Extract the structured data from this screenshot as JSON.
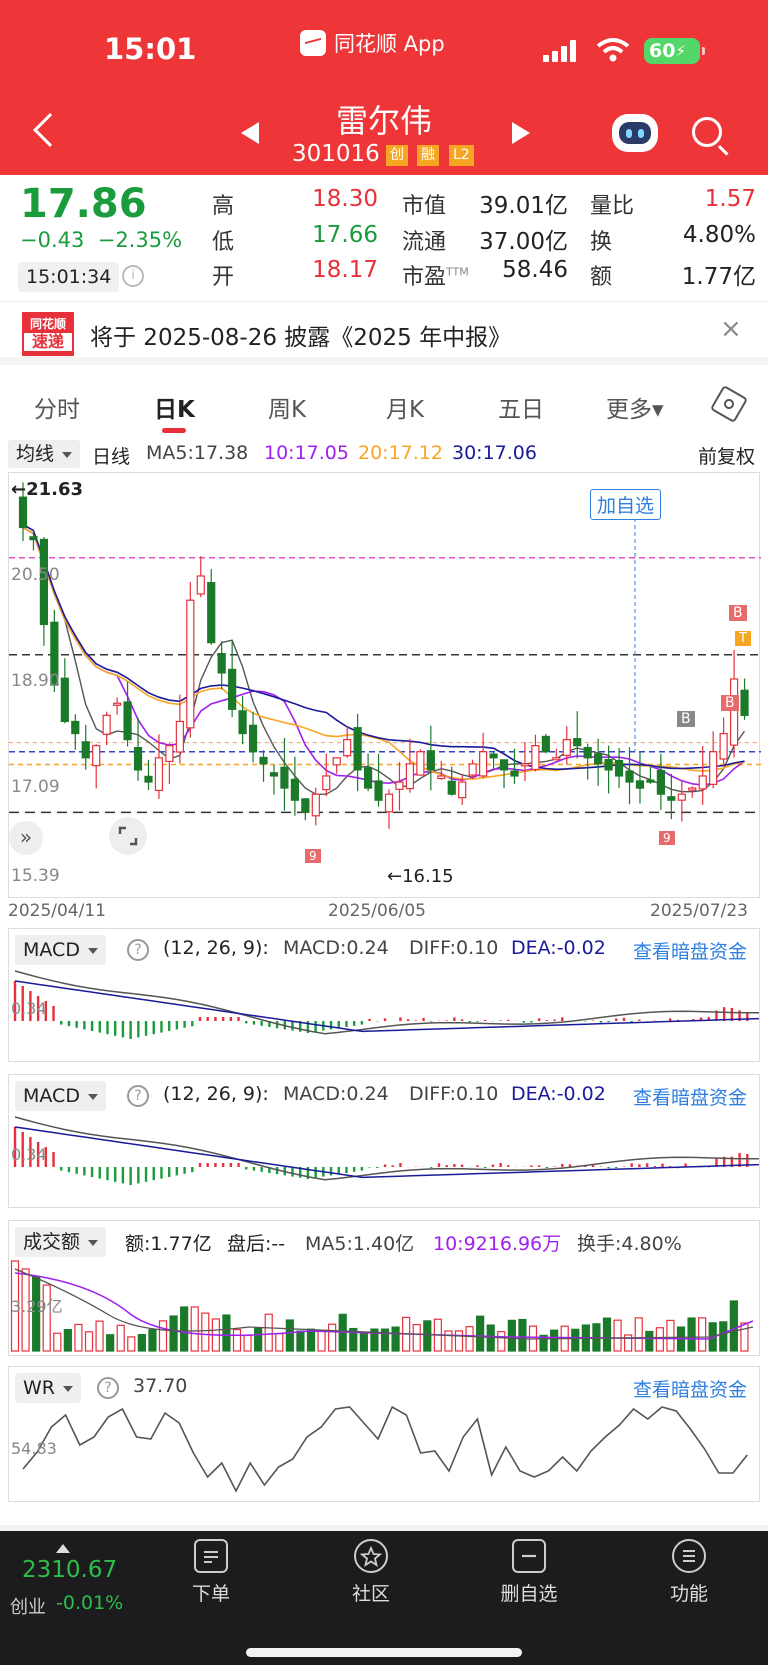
{
  "status": {
    "time": "15:01",
    "app_name": "同花顺 App",
    "battery": "60"
  },
  "header": {
    "name": "雷尔伟",
    "code": "301016",
    "tags": [
      "创",
      "融",
      "L2"
    ]
  },
  "quote": {
    "price": "17.86",
    "change": "−0.43",
    "change_pct": "−2.35%",
    "time": "15:01:34",
    "high_label": "高",
    "high": "18.30",
    "low_label": "低",
    "low": "17.66",
    "open_label": "开",
    "open": "18.17",
    "mcap_label": "市值",
    "mcap": "39.01亿",
    "float_label": "流通",
    "float": "37.00亿",
    "pe_label": "市盈",
    "pe_sup": "TTM",
    "pe": "58.46",
    "vr_label": "量比",
    "vr": "1.57",
    "turn_label": "换",
    "turn": "4.80%",
    "amt_label": "额",
    "amt": "1.77亿"
  },
  "notice": {
    "logo_top": "同花顺",
    "logo_bottom": "速递",
    "text": "将于 2025-08-26 披露《2025 年中报》",
    "close": "×"
  },
  "tabs": [
    "分时",
    "日K",
    "周K",
    "月K",
    "五日",
    "更多▾"
  ],
  "ma_bar": {
    "selector": "均线",
    "period": "日线",
    "ma5": "MA5:17.38",
    "ma10": "10:17.05",
    "ma20": "20:17.12",
    "ma30": "30:17.06",
    "adjust": "前复权"
  },
  "kchart": {
    "max_label": "←21.63",
    "min_label": "←16.15",
    "add_watch": "加自选",
    "price_labels": [
      "20.50",
      "18.90",
      "17.09",
      "15.39"
    ],
    "dates": [
      "2025/04/11",
      "2025/06/05",
      "2025/07/23"
    ],
    "markers": [
      "B",
      "B",
      "B",
      "T",
      "9",
      "9"
    ]
  },
  "macd1": {
    "selector": "MACD",
    "params": "(12, 26, 9):",
    "macd": "MACD:0.24",
    "diff": "DIFF:0.10",
    "dea": "DEA:-0.02",
    "link": "查看暗盘资金",
    "axis": "0.34"
  },
  "macd2": {
    "selector": "MACD",
    "params": "(12, 26, 9):",
    "macd": "MACD:0.24",
    "diff": "DIFF:0.10",
    "dea": "DEA:-0.02",
    "link": "查看暗盘资金",
    "axis": "0.34"
  },
  "volume": {
    "selector": "成交额",
    "amt": "额:1.77亿",
    "after": "盘后:--",
    "ma5": "MA5:1.40亿",
    "ma10": "10:9216.96万",
    "turn": "换手:4.80%",
    "axis": "3.29亿"
  },
  "wr": {
    "selector": "WR",
    "value": "37.70",
    "link": "查看暗盘资金",
    "axis": "54.83"
  },
  "bottom": {
    "index_value": "2310.67",
    "index_name": "创业",
    "index_pct": "-0.01%",
    "items": [
      "下单",
      "社区",
      "删自选",
      "功能"
    ]
  },
  "colors": {
    "header": "#ee3638",
    "up": "#e8303a",
    "down": "#1a9b3c",
    "ma10": "#a020f0",
    "ma20": "#f6a623",
    "ma30": "#1a1a9b",
    "link": "#2f7fe0"
  }
}
